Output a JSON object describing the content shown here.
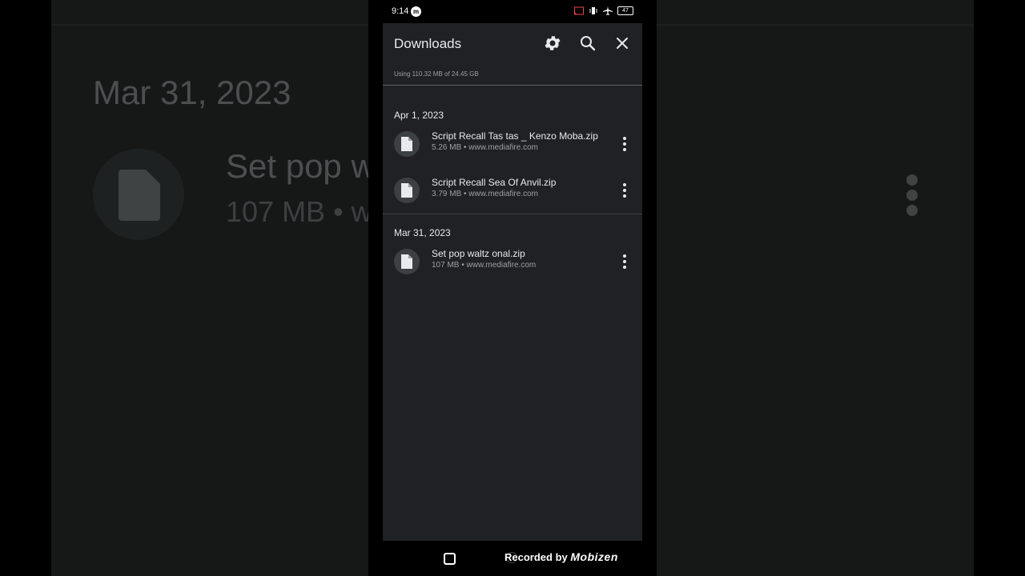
{
  "status": {
    "time": "9:14",
    "app_badge": "m",
    "battery": "47"
  },
  "header": {
    "title": "Downloads"
  },
  "storage": {
    "text": "Using 110.32 MB of 24.45 GB"
  },
  "groups": [
    {
      "date": "Apr 1, 2023",
      "items": [
        {
          "name": "Script Recall Tas tas _ Kenzo Moba.zip",
          "meta": "5.26 MB • www.mediafire.com"
        },
        {
          "name": "Script Recall Sea Of Anvil.zip",
          "meta": "3.79 MB • www.mediafire.com"
        }
      ]
    },
    {
      "date": "Mar 31, 2023",
      "items": [
        {
          "name": "Set pop waltz onal.zip",
          "meta": "107 MB • www.mediafire.com"
        }
      ]
    }
  ],
  "background": {
    "date": "Mar 31, 2023",
    "name": "Set pop w",
    "meta": "107 MB • w"
  },
  "watermark": {
    "prefix": "Recorded by",
    "brand": "Mobizen"
  },
  "colors": {
    "surface": "#202124",
    "text": "#e8eaed",
    "secondary": "#9aa0a6"
  }
}
